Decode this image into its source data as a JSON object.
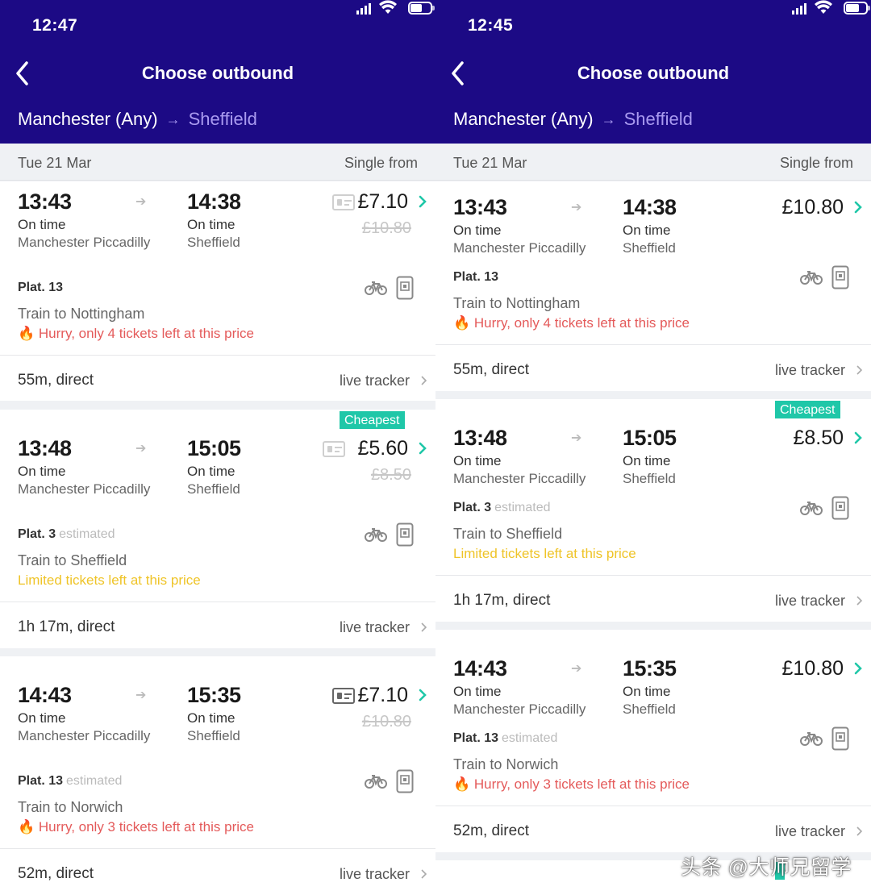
{
  "left": {
    "status_time": "12:47",
    "header": {
      "title": "Choose outbound",
      "origin": "Manchester (Any)",
      "arrow": "→",
      "destination": "Sheffield"
    },
    "date_row": {
      "date": "Tue 21 Mar",
      "label": "Single from"
    },
    "journeys": [
      {
        "depart": "13:43",
        "arrive": "14:38",
        "depart_status": "On time",
        "arrive_status": "On time",
        "from": "Manchester Piccadilly",
        "to": "Sheffield",
        "price": "£7.10",
        "old_price": "£10.80",
        "platform": "Plat. 13",
        "platform_note": "",
        "train_to": "Train to Nottingham",
        "alert": "Hurry, only 4 tickets left at this price",
        "alert_type": "hurry",
        "duration": "55m, direct",
        "tracker": "live tracker",
        "badge": ""
      },
      {
        "depart": "13:48",
        "arrive": "15:05",
        "depart_status": "On time",
        "arrive_status": "On time",
        "from": "Manchester Piccadilly",
        "to": "Sheffield",
        "price": "£5.60",
        "old_price": "£8.50",
        "platform": "Plat. 3",
        "platform_note": "estimated",
        "train_to": "Train to Sheffield",
        "alert": "Limited tickets left at this price",
        "alert_type": "limited",
        "duration": "1h 17m, direct",
        "tracker": "live tracker",
        "badge": "Cheapest"
      },
      {
        "depart": "14:43",
        "arrive": "15:35",
        "depart_status": "On time",
        "arrive_status": "On time",
        "from": "Manchester Piccadilly",
        "to": "Sheffield",
        "price": "£7.10",
        "old_price": "£10.80",
        "platform": "Plat. 13",
        "platform_note": "estimated",
        "train_to": "Train to Norwich",
        "alert": "Hurry, only 3 tickets left at this price",
        "alert_type": "hurry",
        "duration": "52m, direct",
        "tracker": "live tracker",
        "badge": ""
      }
    ]
  },
  "right": {
    "status_time": "12:45",
    "header": {
      "title": "Choose outbound",
      "origin": "Manchester (Any)",
      "arrow": "→",
      "destination": "Sheffield"
    },
    "date_row": {
      "date": "Tue 21 Mar",
      "label": "Single from"
    },
    "journeys": [
      {
        "depart": "13:43",
        "arrive": "14:38",
        "depart_status": "On time",
        "arrive_status": "On time",
        "from": "Manchester Piccadilly",
        "to": "Sheffield",
        "price": "£10.80",
        "platform": "Plat. 13",
        "platform_note": "",
        "train_to": "Train to Nottingham",
        "alert": "Hurry, only 4 tickets left at this price",
        "alert_type": "hurry",
        "duration": "55m, direct",
        "tracker": "live tracker",
        "badge": ""
      },
      {
        "depart": "13:48",
        "arrive": "15:05",
        "depart_status": "On time",
        "arrive_status": "On time",
        "from": "Manchester Piccadilly",
        "to": "Sheffield",
        "price": "£8.50",
        "platform": "Plat. 3",
        "platform_note": "estimated",
        "train_to": "Train to Sheffield",
        "alert": "Limited tickets left at this price",
        "alert_type": "limited",
        "duration": "1h 17m, direct",
        "tracker": "live tracker",
        "badge": "Cheapest"
      },
      {
        "depart": "14:43",
        "arrive": "15:35",
        "depart_status": "On time",
        "arrive_status": "On time",
        "from": "Manchester Piccadilly",
        "to": "Sheffield",
        "price": "£10.80",
        "platform": "Plat. 13",
        "platform_note": "estimated",
        "train_to": "Train to Norwich",
        "alert": "Hurry, only 3 tickets left at this price",
        "alert_type": "hurry",
        "duration": "52m, direct",
        "tracker": "live tracker",
        "badge": ""
      }
    ]
  },
  "watermark": "头条 @大师兄留学",
  "colors": {
    "header_bg": "#1c0a85",
    "accent_teal": "#1fc7a8",
    "hurry_red": "#e45a5a",
    "limited_yellow": "#efc428"
  },
  "icons": [
    "back-arrow-icon",
    "signal-icon",
    "wifi-icon",
    "battery-icon",
    "railcard-icon",
    "bike-icon",
    "mobile-ticket-icon",
    "chevron-right-icon",
    "flame-icon"
  ]
}
